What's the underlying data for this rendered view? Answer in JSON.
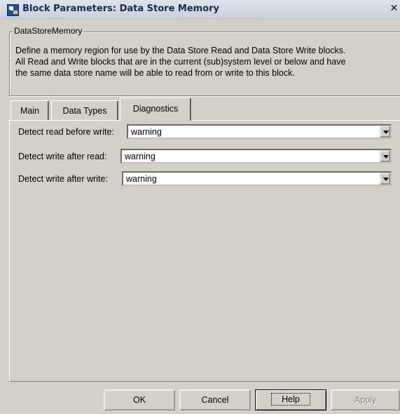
{
  "window": {
    "title": "Block Parameters: Data Store Memory",
    "close_glyph": "✕"
  },
  "group": {
    "legend": "DataStoreMemory",
    "description": [
      "Define a memory region for use by the Data Store Read and Data Store Write blocks.",
      "All Read and Write blocks that are in the current (sub)system level or below and have",
      "the same data store name will be able to read from or write to this block."
    ]
  },
  "tabs": [
    {
      "label": "Main",
      "active": false
    },
    {
      "label": "Data Types",
      "active": false
    },
    {
      "label": "Diagnostics",
      "active": true
    }
  ],
  "diagnostics": [
    {
      "label": "Detect read before write:",
      "value": "warning"
    },
    {
      "label": "Detect write after read:",
      "value": "warning"
    },
    {
      "label": "Detect write after write:",
      "value": "warning"
    }
  ],
  "buttons": {
    "ok": "OK",
    "cancel": "Cancel",
    "help": "Help",
    "apply": "Apply"
  },
  "icons": {
    "app": "block-parameters-icon",
    "dropdown": "chevron-down-icon"
  }
}
